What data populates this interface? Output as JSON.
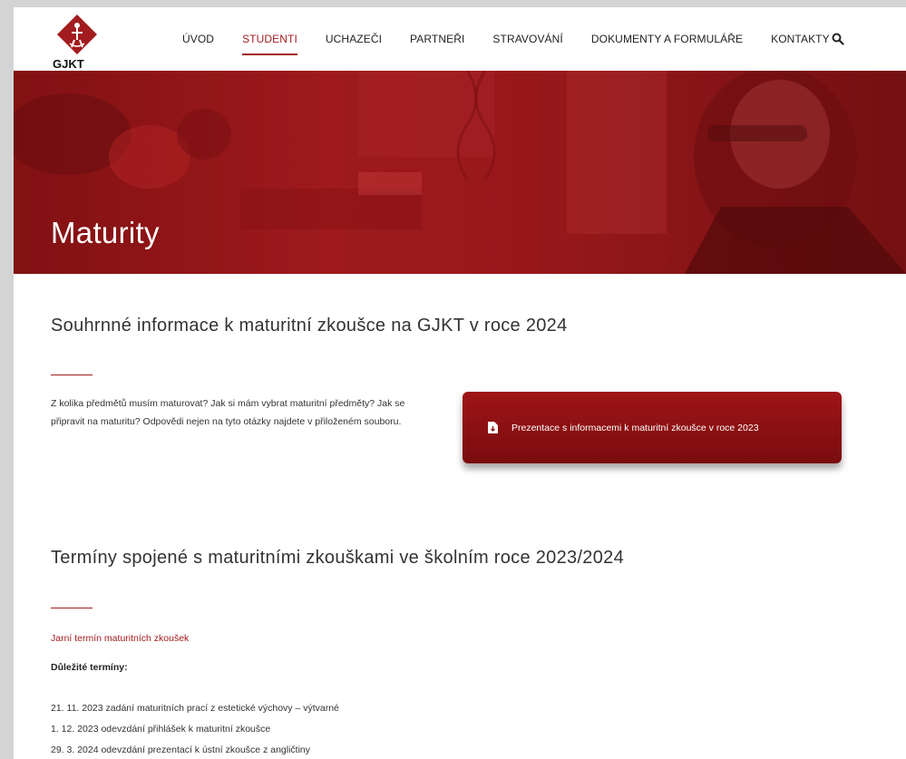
{
  "header": {
    "logo_text": "GJKT",
    "nav": [
      {
        "label": "ÚVOD",
        "active": false
      },
      {
        "label": "STUDENTI",
        "active": true
      },
      {
        "label": "UCHAZEČI",
        "active": false
      },
      {
        "label": "PARTNEŘI",
        "active": false
      },
      {
        "label": "STRAVOVÁNÍ",
        "active": false
      },
      {
        "label": "DOKUMENTY A FORMULÁŘE",
        "active": false
      },
      {
        "label": "KONTAKTY",
        "active": false
      }
    ],
    "search_icon": "search-icon"
  },
  "hero": {
    "title": "Maturity"
  },
  "section1": {
    "heading": "Souhrnné informace k maturitní zkoušce na GJKT v roce 2024",
    "intro": "Z kolika předmětů musím maturovat? Jak si mám vybrat maturitní předměty? Jak se připravit na maturitu? Odpovědi nejen na tyto otázky najdete v přiloženém souboru.",
    "button_label": "Prezentace s informacemi k maturitní zkoušce v roce 2023",
    "button_icon": "file-download-icon"
  },
  "section2": {
    "heading": "Termíny spojené s maturitními zkouškami ve školním roce 2023/2024",
    "subheading": "Jarní termín maturitních zkoušek",
    "dates_label": "Důležité termíny:",
    "dates": [
      "21. 11. 2023 zadání maturitních prací z estetické výchovy – výtvarné",
      "1. 12. 2023 odevzdání přihlášek k maturitní zkoušce",
      "29. 3. 2024 odevzdání prezentací k ústní zkoušce z angličtiny"
    ]
  },
  "colors": {
    "accent": "#a21c1f",
    "button": "#8b1012"
  }
}
